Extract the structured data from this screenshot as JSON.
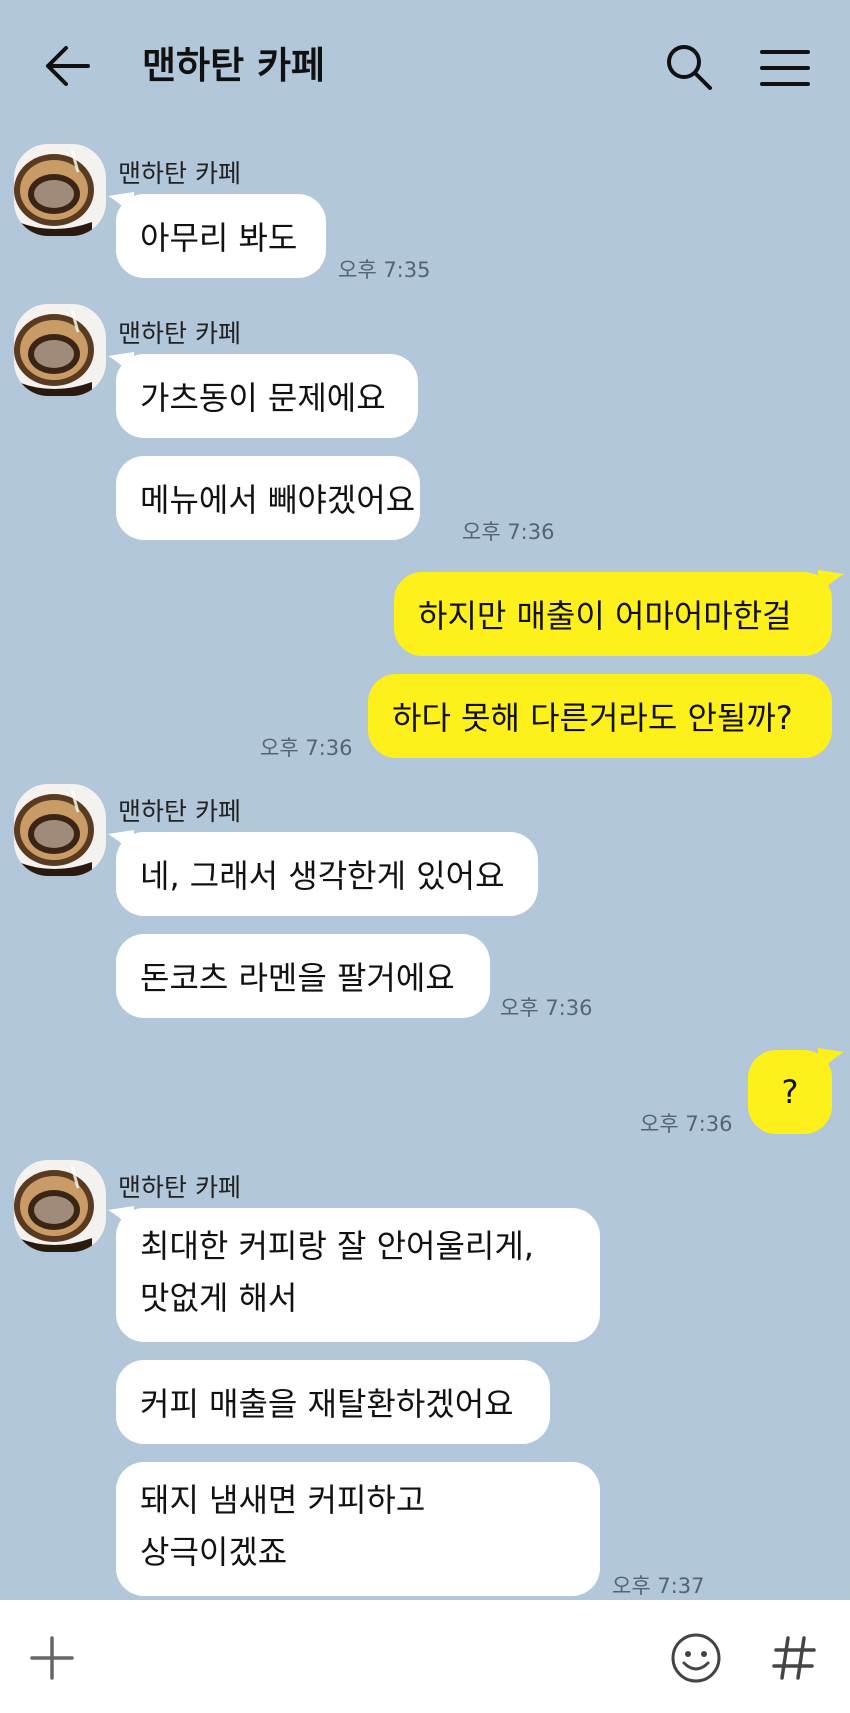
{
  "header": {
    "title": "맨하탄 카페",
    "back_icon": "arrow-left-icon",
    "search_icon": "search-icon",
    "menu_icon": "hamburger-menu-icon"
  },
  "messages": [
    {
      "group": "a",
      "sender": "맨하탄 카페",
      "avatar": "coffee-dripper-avatar",
      "bubbles": [
        "아무리 봐도"
      ],
      "time": "오후 7:35"
    },
    {
      "group": "b",
      "sender": "맨하탄 카페",
      "bubbles": [
        "가츠동이 문제에요",
        "메뉴에서 빼야겠어요"
      ],
      "time": "오후 7:36"
    },
    {
      "group": "c",
      "sender": "me",
      "bubbles": [
        "하지만 매출이 어마어마한걸",
        "하다 못해 다른거라도 안될까?"
      ],
      "time": "오후 7:36"
    },
    {
      "group": "d",
      "sender": "맨하탄 카페",
      "bubbles": [
        "네, 그래서 생각한게 있어요",
        "돈코츠 라멘을 팔거에요"
      ],
      "time": "오후 7:36"
    },
    {
      "group": "e",
      "sender": "me",
      "bubbles": [
        "?"
      ],
      "time": "오후 7:36"
    },
    {
      "group": "f",
      "sender": "맨하탄 카페",
      "bubbles": [
        "최대한 커피랑 잘 안어울리게,\n맛없게 해서",
        "커피 매출을 재탈환하겠어요",
        "돼지 냄새면 커피하고\n상극이겠죠"
      ],
      "time": "오후 7:37"
    }
  ],
  "input_bar": {
    "attach_icon": "plus-icon",
    "emoji_icon": "emoji-smile-icon",
    "hashtag_icon": "hashtag-icon"
  },
  "colors": {
    "background": "#b2c7da",
    "incoming_bubble": "#ffffff",
    "outgoing_bubble": "#fef01b"
  }
}
